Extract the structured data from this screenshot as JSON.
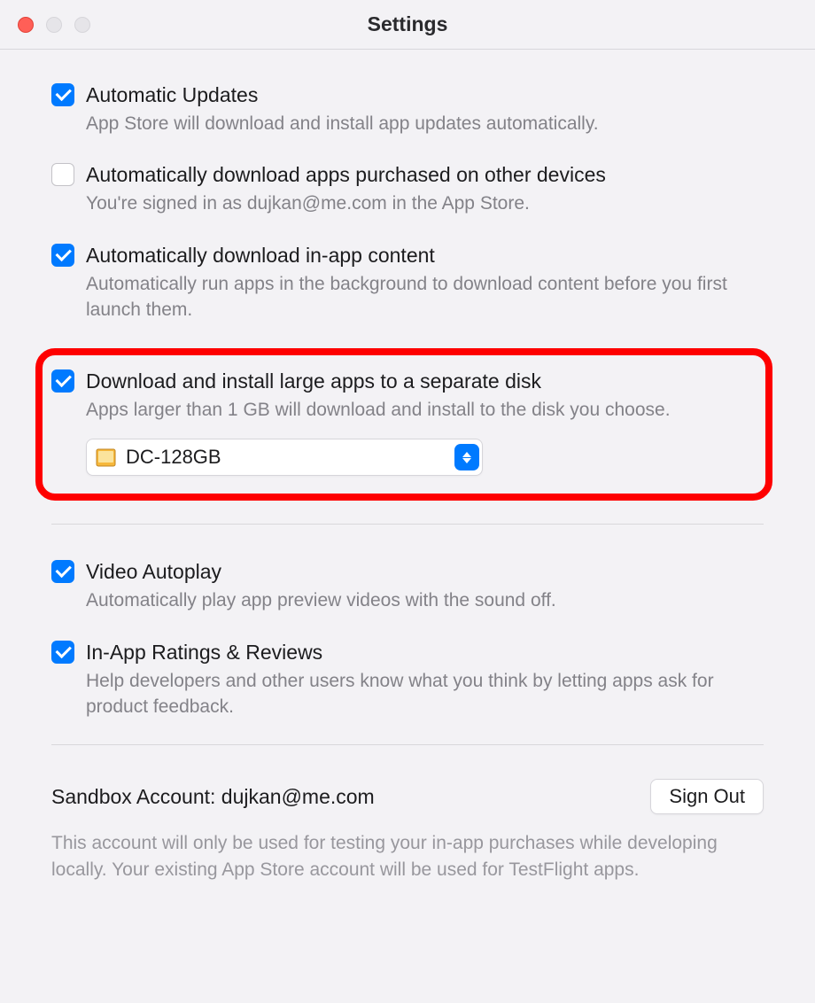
{
  "window": {
    "title": "Settings"
  },
  "settings": {
    "auto_updates": {
      "label": "Automatic Updates",
      "desc": "App Store will download and install app updates automatically.",
      "checked": true
    },
    "auto_download_purchased": {
      "label": "Automatically download apps purchased on other devices",
      "desc": "You're signed in as dujkan@me.com in the App Store.",
      "checked": false
    },
    "auto_inapp_content": {
      "label": "Automatically download in-app content",
      "desc": "Automatically run apps in the background to download content before you first launch them.",
      "checked": true
    },
    "large_apps_disk": {
      "label": "Download and install large apps to a separate disk",
      "desc": "Apps larger than 1 GB will download and install to the disk you choose.",
      "checked": true,
      "selected_disk": "DC-128GB"
    },
    "video_autoplay": {
      "label": "Video Autoplay",
      "desc": "Automatically play app preview videos with the sound off.",
      "checked": true
    },
    "inapp_ratings": {
      "label": "In-App Ratings & Reviews",
      "desc": "Help developers and other users know what you think by letting apps ask for product feedback.",
      "checked": true
    }
  },
  "sandbox": {
    "label": "Sandbox Account: dujkan@me.com",
    "sign_out_label": "Sign Out",
    "desc": "This account will only be used for testing your in-app purchases while developing locally. Your existing App Store account will be used for TestFlight apps."
  }
}
